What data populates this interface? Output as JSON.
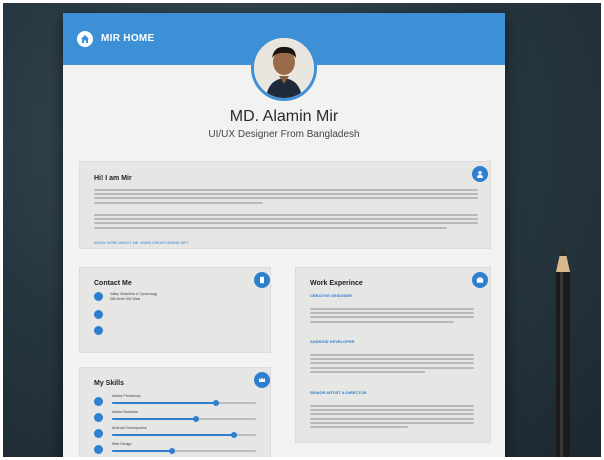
{
  "header": {
    "home_label": "MIR HOME",
    "home_icon": "home-icon"
  },
  "profile": {
    "name": "MD. Alamin Mir",
    "title": "UI/UX Designer From Bangladesh"
  },
  "about": {
    "heading": "Hi! I am Mir",
    "icon": "user-icon",
    "link_text": "KNOW MORE ABOUT ME: WWW.CREATIVEMINE.NET"
  },
  "contact": {
    "heading": "Contact Me",
    "icon": "phone-icon",
    "rows": [
      {
        "icon": "location-icon",
        "text": "Valley Obstetrics & Gynecology\n585 North 500 West"
      },
      {
        "icon": "email-icon",
        "text": ""
      },
      {
        "icon": "phone-icon",
        "text": ""
      }
    ]
  },
  "skills": {
    "heading": "My Skills",
    "icon": "crown-icon",
    "items": [
      {
        "name": "Adobe Photoshop",
        "level": 0.72
      },
      {
        "name": "Adobe Illustrator",
        "level": 0.58
      },
      {
        "name": "Android Development",
        "level": 0.85
      },
      {
        "name": "Web Design",
        "level": 0.42
      }
    ]
  },
  "work": {
    "heading": "Work Experince",
    "icon": "briefcase-icon",
    "jobs": [
      {
        "title": "CREATIVE DESIGNER",
        "meta": ""
      },
      {
        "title": "ANDROID DEVELOPER",
        "meta": ""
      },
      {
        "title": "SENIOR ARTIST & DIRECTOR",
        "meta": ""
      }
    ]
  },
  "colors": {
    "accent": "#3d8fd6",
    "icon_blue": "#2e7fcf",
    "paper": "#f2f2f0",
    "card": "#e6e6e4",
    "backdrop": "#263640"
  }
}
